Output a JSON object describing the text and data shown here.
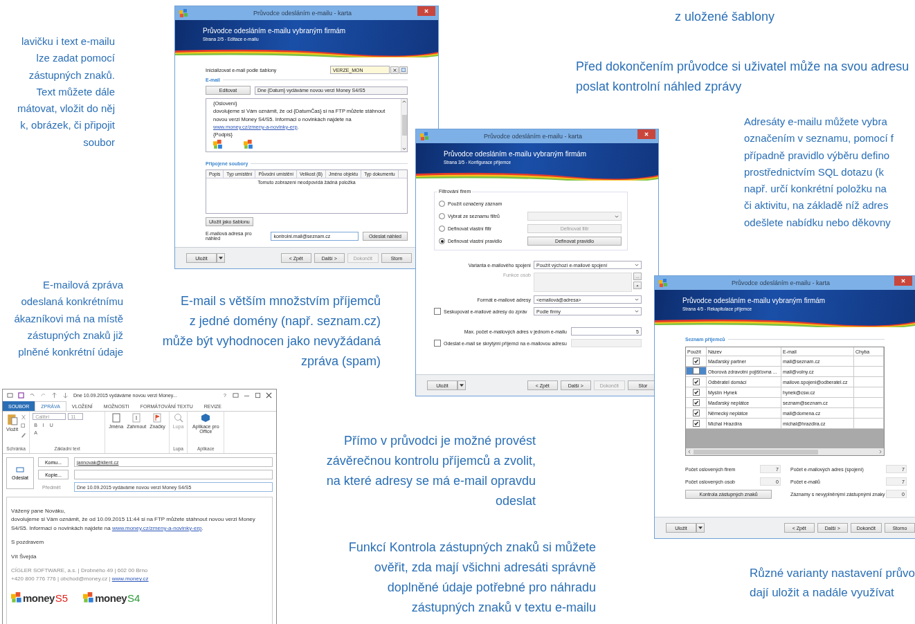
{
  "callouts": [
    {
      "lines": [
        "z uložené šablony"
      ]
    },
    {
      "lines": [
        "Před dokončením průvodce si uživatel může na svou adresu",
        "poslat kontrolní náhled zprávy"
      ]
    },
    {
      "lines": [
        "Adresáty e-mailu můžete vybra",
        "označením v seznamu, pomocí f",
        "případně pravidlo výběru defino",
        "prostřednictvím SQL dotazu (k",
        "např. určí konkrétní položku na",
        "či aktivitu, na základě níž adres",
        "odešlete nabídku nebo děkovny"
      ]
    },
    {
      "lines": [
        "lavičku i text e-mailu",
        "lze zadat pomocí",
        "zástupných znaků.",
        "Text můžete dále",
        "mátovat, vložit do něj",
        "k, obrázek, či připojit",
        "soubor"
      ]
    },
    {
      "lines": [
        "E-mailová zpráva",
        "odeslaná konkrétnímu",
        "ákazníkovi má na místě",
        "zástupných znaků již",
        "plněné konkrétní údaje"
      ]
    },
    {
      "lines": [
        "E-mail s větším množstvím příjemců",
        "z jedné domény (např. seznam.cz)",
        "může být vyhodnocen jako nevyžádaná",
        "zpráva (spam)"
      ]
    },
    {
      "lines": [
        "Přímo v průvodci je možné provést",
        "závěrečnou kontrolu příjemců a zvolit,",
        "na které adresy se má e-mail opravdu",
        "odeslat"
      ]
    },
    {
      "lines": [
        "Funkcí Kontrola zástupných znaků si můžete",
        "ověřit, zda mají všichni adresáti správně",
        "doplněné údaje potřebné pro náhradu",
        "zástupných znaků v textu e-mailu"
      ]
    },
    {
      "lines": [
        "Různé varianty nastavení průvo",
        "dají uložit a nadále využívat"
      ]
    }
  ],
  "wizard_step2": {
    "title": "Průvodce odesláním e-mailu - karta",
    "banner_title": "Průvodce odesláním e-mailu vybraným firmám",
    "banner_subtitle": "Strana 2/5 - Editace e-mailu",
    "template_label": "Inicializovat e-mail podle šablony",
    "template_value": "VERZE_MON",
    "email_section": "E-mail",
    "edit_button": "Editovat",
    "subject": "Dne {Datum} vydáváme novou verzi Money S4/S5",
    "body": {
      "greeting": "{Oslovení}",
      "text": "dovolujeme si Vám oznámit, že od {DatumČas} si na FTP můžete stáhnout novou verzi Money S4/S5. Informaci o novinkách najdete na ",
      "link": "www.money.cz/zmeny-a-novinky-erp",
      "end": ".",
      "signature": "{Podpis}"
    },
    "attachments_section": "Připojené soubory",
    "columns": [
      "Popis",
      "Typ umístění",
      "Původní umístění",
      "Velikost (B)",
      "Jméno objektu",
      "Typ dokumentu"
    ],
    "empty_message": "Tomuto zobrazení neodpovídá žádná položka",
    "save_template": "Uložit jako šablonu",
    "preview_label": "E-mailová adresa pro náhled",
    "preview_value": "kontrolni.mail@seznam.cz",
    "send_preview": "Odeslat náhled",
    "footer": {
      "save": "Uložit",
      "buttons": [
        {
          "label": "< Zpět",
          "disabled": false
        },
        {
          "label": "Další >",
          "disabled": false
        },
        {
          "label": "Dokončit",
          "disabled": true
        },
        {
          "label": "Storn",
          "disabled": false
        }
      ]
    }
  },
  "wizard_step3": {
    "title": "Průvodce odesláním e-mailu - karta",
    "banner_title": "Průvodce odesláním e-mailu vybraným firmám",
    "banner_subtitle": "Strana 3/5 - Konfigurace příjemce",
    "filter_group": "Filtrování firem",
    "filters": [
      {
        "label": "Použít označený záznam",
        "selected": false,
        "kind": "plain"
      },
      {
        "label": "Vybrat ze seznamu filtrů",
        "selected": false,
        "kind": "select",
        "disabled": true
      },
      {
        "label": "Definovat vlastní filtr",
        "selected": false,
        "kind": "button",
        "button": "Definovat filtr",
        "disabled": true
      },
      {
        "label": "Definovat vlastní pravidlo",
        "selected": true,
        "kind": "button",
        "button": "Definovat pravidlo",
        "disabled": false
      }
    ],
    "rows": [
      {
        "kind": "select",
        "label": "Varianta e-mailového spojení",
        "value": "Použít výchozí e-mailové spojení"
      },
      {
        "kind": "list",
        "label": "Funkce osob",
        "disabled": true,
        "buttons": [
          "...",
          "×"
        ]
      },
      {
        "kind": "select",
        "label": "Formát e-mailové adresy",
        "value": "<emailová@adresa>"
      },
      {
        "kind": "check_select",
        "label": "Seskupovat e-mailové adresy do zpráv",
        "checked": false,
        "value": "Podle firmy"
      },
      {
        "kind": "number",
        "label": "Max. počet e-mailových adres v jednom e-mailu",
        "value": "5"
      },
      {
        "kind": "check_input",
        "label": "Odeslat e-mail se skrytými příjemci na e-mailovou adresu",
        "checked": false,
        "disabled": true
      }
    ],
    "footer": {
      "save": "Uložit",
      "buttons": [
        {
          "label": "< Zpět",
          "disabled": false
        },
        {
          "label": "Další >",
          "disabled": false
        },
        {
          "label": "Dokončit",
          "disabled": true
        },
        {
          "label": "Stor",
          "disabled": false
        }
      ]
    }
  },
  "wizard_step4": {
    "title": "Průvodce odesláním e-mailu - karta",
    "banner_title": "Průvodce odesláním e-mailu vybraným firmám",
    "banner_subtitle": "Strana 4/5 - Rekapitulace příjemce",
    "recipients_section": "Seznam příjemců",
    "columns": [
      "Použít",
      "Název",
      "E-mail",
      "Chyba"
    ],
    "recipients": [
      {
        "name": "Maďarský partner",
        "email": "mail@seznam.cz",
        "checked": true,
        "selected": false
      },
      {
        "name": "Oborová zdravotní pojišťovna ...",
        "email": "mail@volny.cz",
        "checked": false,
        "selected": true
      },
      {
        "name": "Odběratel domácí",
        "email": "mailove.spojeni@odberatel.cz",
        "checked": true,
        "selected": false
      },
      {
        "name": "Myslín Hynek",
        "email": "hynek@csw.cz",
        "checked": true,
        "selected": false
      },
      {
        "name": "Maďarský neplátce",
        "email": "seznam@seznam.cz",
        "checked": true,
        "selected": false
      },
      {
        "name": "Německý neplátce",
        "email": "mail@domena.cz",
        "checked": true,
        "selected": false
      },
      {
        "name": "Michal Hrazdíra",
        "email": "michal@hrazdira.cz",
        "checked": true,
        "selected": false
      }
    ],
    "stats_left": [
      {
        "label": "Počet oslovených firem",
        "value": "7"
      },
      {
        "label": "Počet oslovených osob",
        "value": "0"
      }
    ],
    "check_button": "Kontrola zástupných znaků",
    "stats_right": [
      {
        "label": "Počet e-mailových adres (spojení)",
        "value": "7"
      },
      {
        "label": "Počet e-mailů",
        "value": "7"
      },
      {
        "label": "Záznamy s nevyplněnými zástupnými znaky",
        "value": "0"
      }
    ],
    "footer": {
      "save": "Uložit",
      "buttons": [
        {
          "label": "< Zpět",
          "disabled": false
        },
        {
          "label": "Další >",
          "disabled": false
        },
        {
          "label": "Dokončit",
          "disabled": false
        },
        {
          "label": "Storno",
          "disabled": false
        }
      ]
    }
  },
  "outlook": {
    "title": "Dne 10.09.2015 vydáváme novou verzi Money...",
    "help": "?",
    "tabs": [
      {
        "label": "SOUBOR",
        "kind": "file",
        "selected": false
      },
      {
        "label": "ZPRÁVA",
        "kind": "tab",
        "selected": true
      },
      {
        "label": "VLOŽENÍ",
        "kind": "tab",
        "selected": false
      },
      {
        "label": "MOŽNOSTI",
        "kind": "tab",
        "selected": false
      },
      {
        "label": "FORMÁTOVÁNÍ TEXTU",
        "kind": "tab",
        "selected": false
      },
      {
        "label": "REVIZE",
        "kind": "tab",
        "selected": false
      }
    ],
    "ribbon": {
      "paste": "Vložit",
      "font": "Calibri",
      "size": "11",
      "styles": [
        "B",
        "I",
        "U"
      ],
      "font_color": "A",
      "buttons": [
        {
          "label": "Jména",
          "disabled": false
        },
        {
          "label": "Zahrnout",
          "disabled": false
        },
        {
          "label": "Značky",
          "disabled": false
        },
        {
          "label": "Lupa",
          "disabled": true
        },
        {
          "label": "Aplikace pro Office",
          "disabled": false
        }
      ],
      "groups": [
        "Schránka",
        "Základní text",
        "Lupa",
        "Aplikace"
      ]
    },
    "send": "Odeslat",
    "to_button": "Komu...",
    "to_value": "jannovak@klient.cz",
    "cc_button": "Kopie...",
    "subject_label": "Předmět",
    "subject_value": "Dne 10.09.2015 vydáváme novou verzi Money S4/S5",
    "body": {
      "greeting": "Vážený pane Nováku,",
      "text": "dovolujeme si Vám oznámit, že od 10.09.2015 11:44 si na FTP můžete stáhnout novou verzi Money S4/S5. Informaci o novinkách najdete na ",
      "link": "www.money.cz/zmeny-a-novinky-erp",
      "end": ".",
      "closing": "S pozdravem",
      "name": "Vít Švejda",
      "company": "CÍGLER SOFTWARE, a.s. | Drobného 49 | 602 00 Brno",
      "contact": "+420 800 776 776 | obchod@money.cz | ",
      "web": "www.money.cz"
    },
    "logos": [
      {
        "word": "money",
        "edition": "S5",
        "color": "#e2231a"
      },
      {
        "word": "money",
        "edition": "S4",
        "color": "#2f9b3a"
      }
    ]
  }
}
